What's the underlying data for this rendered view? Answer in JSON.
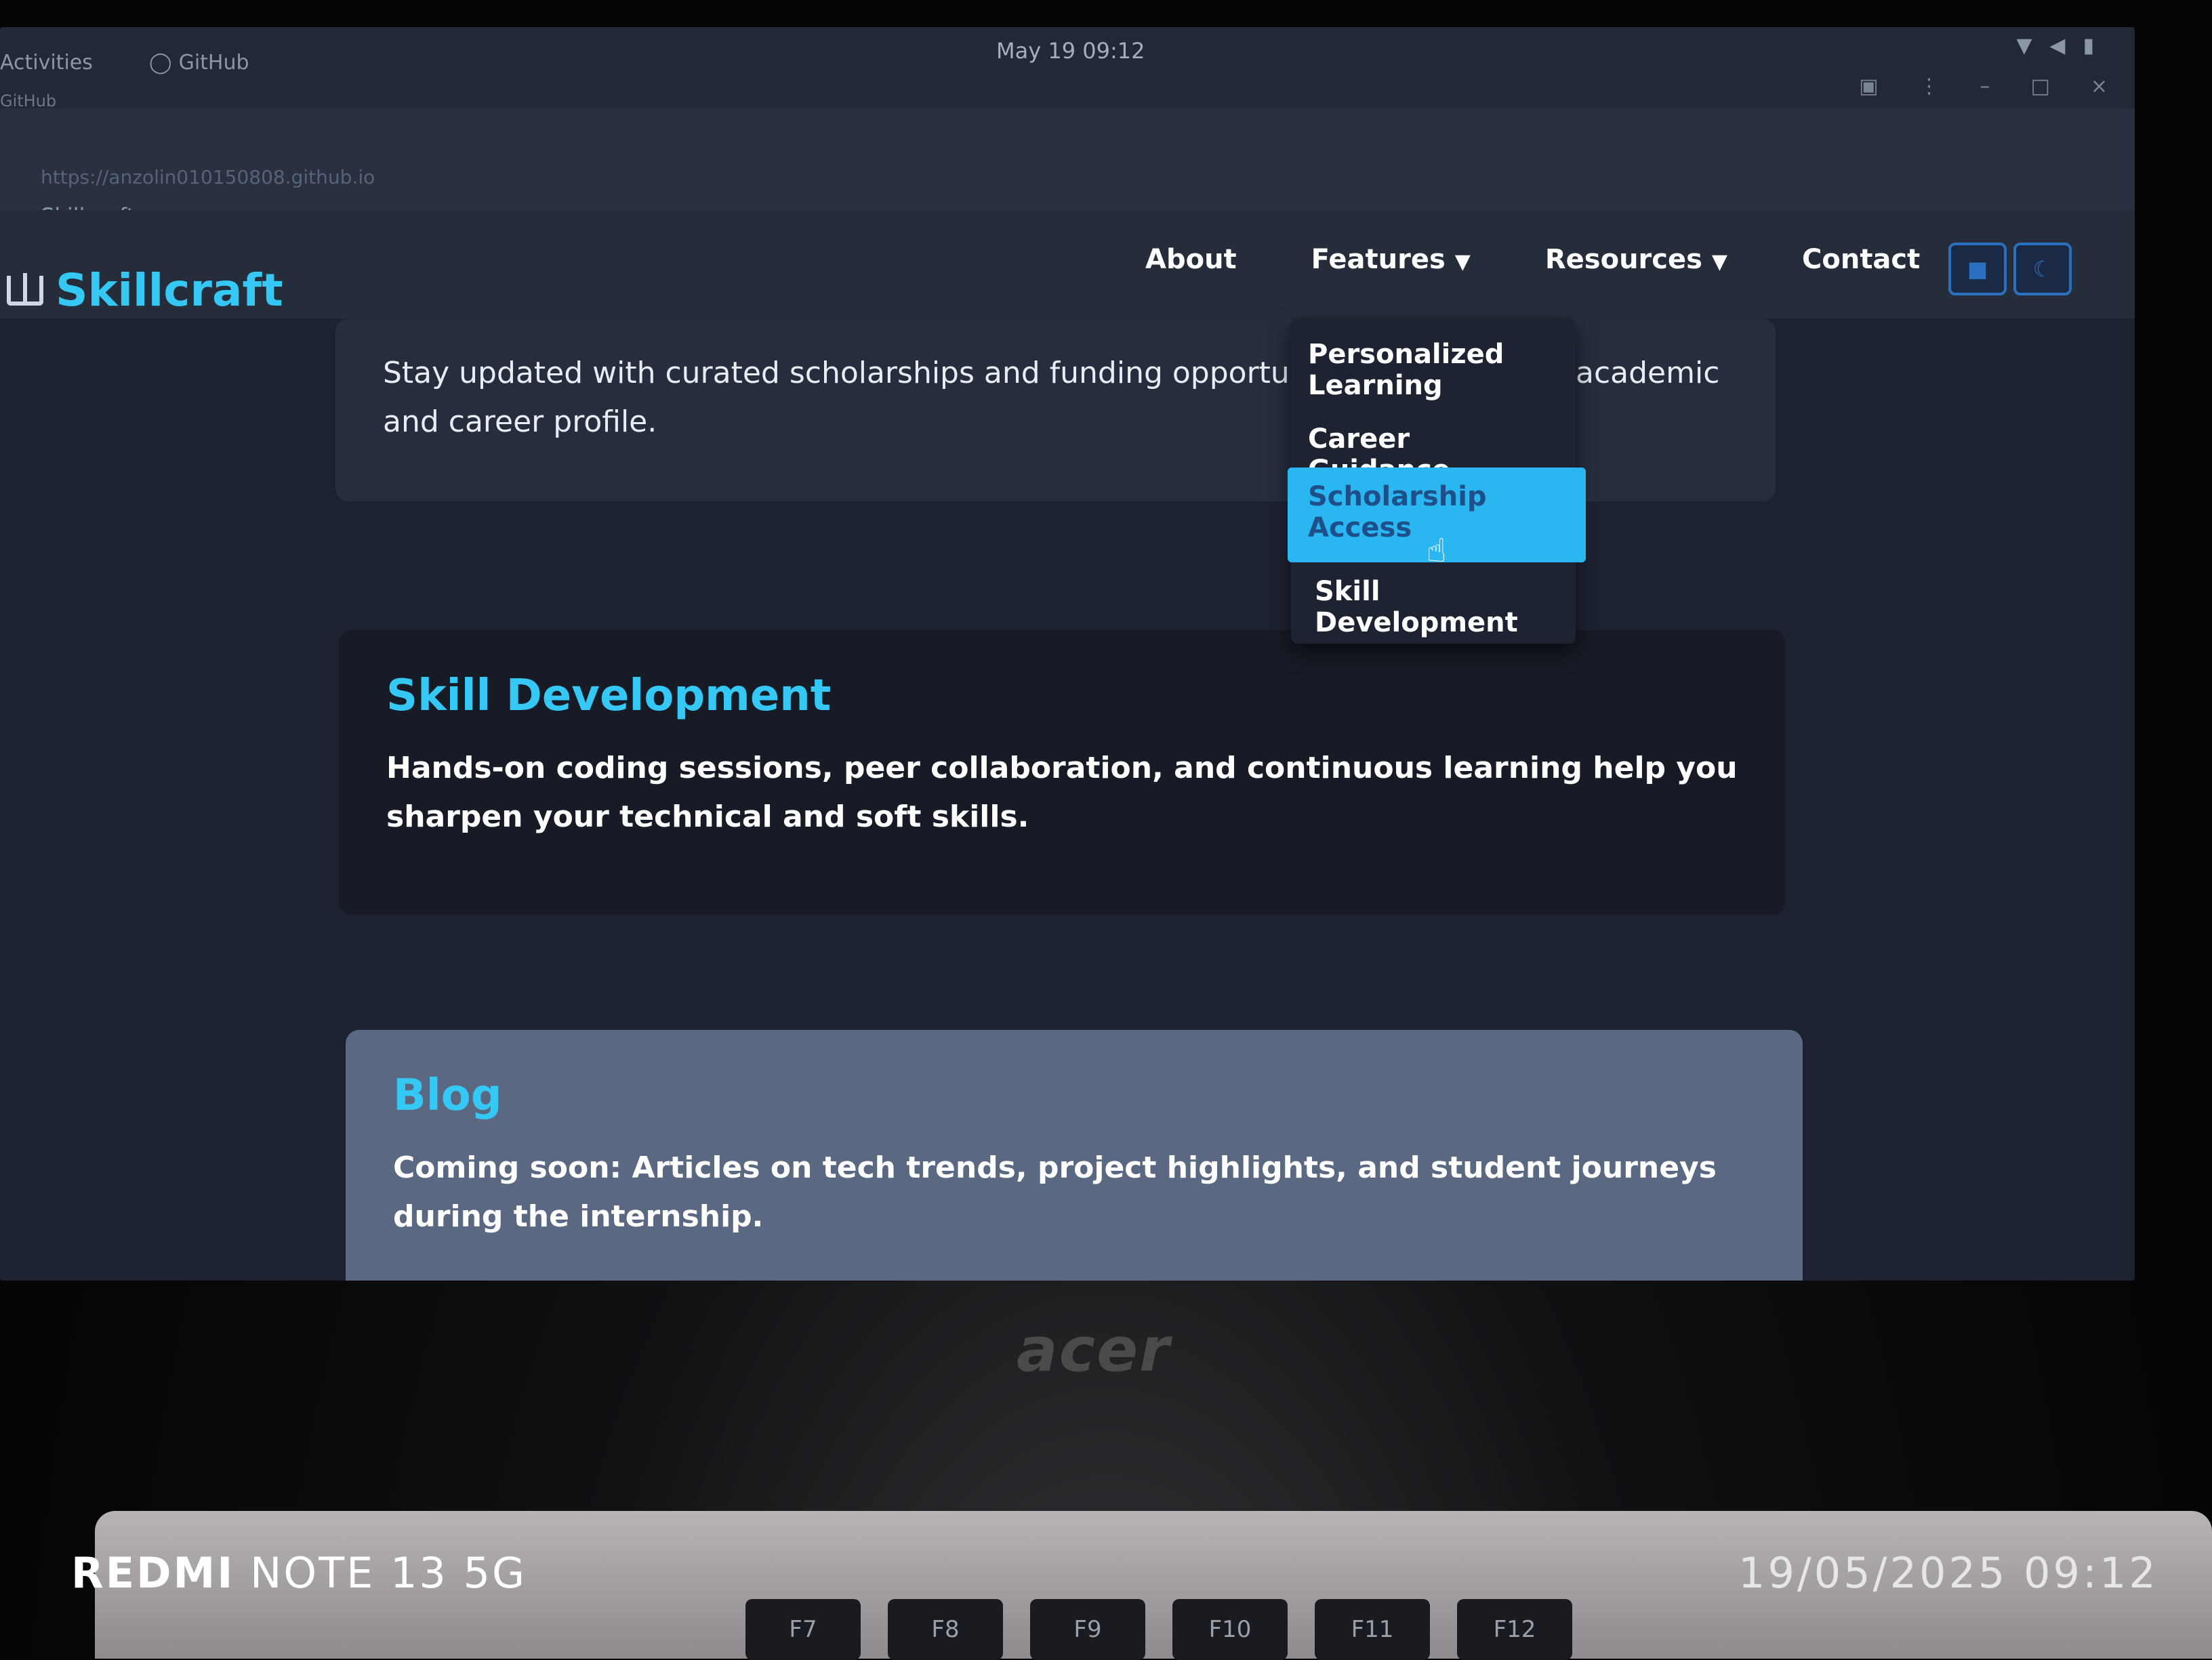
{
  "topbar": {
    "activities": "Activities",
    "app_name": "GitHub",
    "app_sub": "GitHub",
    "clock": "May 19  09:12"
  },
  "browser": {
    "url": "https://anzolin010150808.github.io",
    "tab_title": "Skillcraft"
  },
  "site": {
    "logo": "Skillcraft",
    "nav": [
      {
        "label": "About"
      },
      {
        "label": "Features"
      },
      {
        "label": "Resources"
      },
      {
        "label": "Contact"
      }
    ],
    "dropdown": {
      "items": [
        "Personalized Learning",
        "Career Guidance",
        "Scholarship Access",
        "Skill Development"
      ],
      "active_index": 2
    },
    "cards": [
      {
        "title": "",
        "text_line1": "Stay updated with curated scholarships and funding opportuniti",
        "text_line1_end": "academic",
        "text_line2": "and career profile."
      },
      {
        "title": "Skill Development",
        "text": "Hands-on coding sessions, peer collaboration, and continuous learning help you sharpen your technical and soft skills."
      },
      {
        "title": "Blog",
        "text": "Coming soon: Articles on tech trends, project highlights, and student journeys during the internship."
      }
    ]
  },
  "device": {
    "bezel_brand": "acer",
    "fkeys": [
      "F7",
      "F8",
      "F9",
      "F10",
      "F11",
      "F12"
    ],
    "watermark_brand": "REDMI",
    "watermark_model": "NOTE 13 5G",
    "watermark_datetime": "19/05/2025  09:12"
  },
  "colors": {
    "accent": "#35c8f5",
    "nav_bg": "#262d3a",
    "page_bg": "#1c2230",
    "dropdown_active": "#2ab6f0"
  }
}
